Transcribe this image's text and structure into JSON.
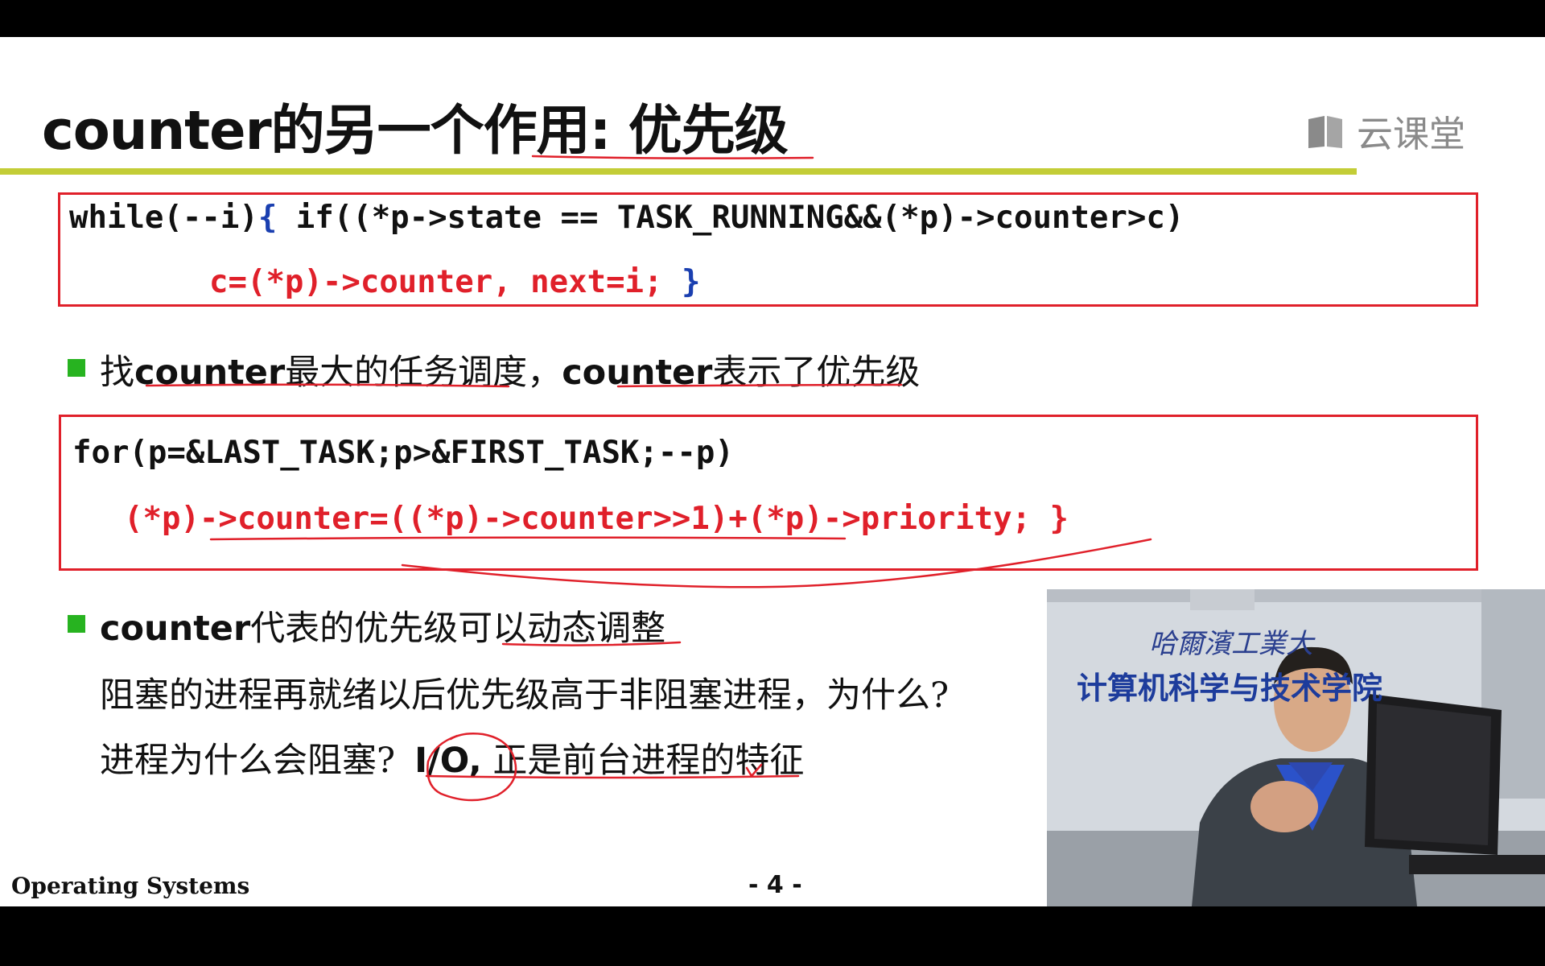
{
  "slide": {
    "title": "counter的另一个作用: 优先级",
    "brand": "云课堂",
    "code_block_1": {
      "line1_a": "while(--i)",
      "line1_b": "{",
      "line1_c": " if((*p->state == TASK_RUNNING&&(*p)->counter>c)",
      "line2_a": "c=(*p)->counter, next=i;",
      "line2_b": " }"
    },
    "bullet_1": {
      "p1": "找",
      "p2": "counter",
      "p3": "最大的任务调度，",
      "p4": "counter",
      "p5": "表示了优先级"
    },
    "code_block_2": {
      "line1": "for(p=&LAST_TASK;p>&FIRST_TASK;--p)",
      "line2": "(*p)->counter=((*p)->counter>>1)+(*p)->priority; }"
    },
    "bullet_2": {
      "p1": "counter",
      "p2": "代表的优先级可以动态调整",
      "line2": "阻塞的进程再就绪以后优先级高于非阻塞进程，为什么?",
      "line3_a": "进程为什么会阻塞?",
      "line3_b": "I/O,",
      "line3_c": " 正是前台进程的特征"
    },
    "footer_left": "Operating Systems",
    "page_number": "- 4 -"
  },
  "video": {
    "school_sign": "哈爾濱工業大",
    "dept_sign": "计算机科学与技术学院"
  },
  "colors": {
    "accent_rule": "#c3cd37",
    "code_border": "#e0202a",
    "bullet": "#27b320",
    "annotation": "#e0202a"
  }
}
